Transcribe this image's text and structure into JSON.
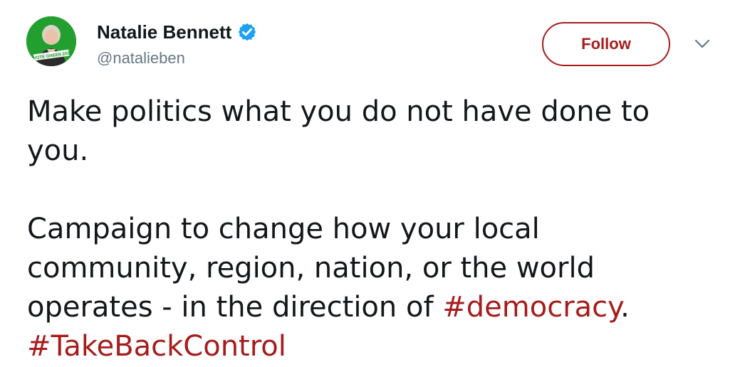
{
  "author": {
    "display_name": "Natalie Bennett",
    "handle": "@natalieben",
    "verified": true,
    "verified_icon": "verified-badge-icon",
    "avatar_banner_text": "#VOTE GREEN 2019"
  },
  "actions": {
    "follow_label": "Follow",
    "more_icon": "chevron-down-icon"
  },
  "tweet": {
    "line1": "Make politics what you do not have done to",
    "line2": "you.",
    "para2_text": "Campaign to change how your local community, region, nation, or the world operates - in the direction of ",
    "hashtag_democracy": "#democracy",
    "period": ".",
    "hashtag_takebackcontrol": "#TakeBackControl"
  },
  "colors": {
    "accent": "#a61c1c",
    "text": "#14171a",
    "secondary_text": "#657786",
    "verified_blue": "#1da1f2",
    "avatar_green": "#1e9b2c"
  }
}
